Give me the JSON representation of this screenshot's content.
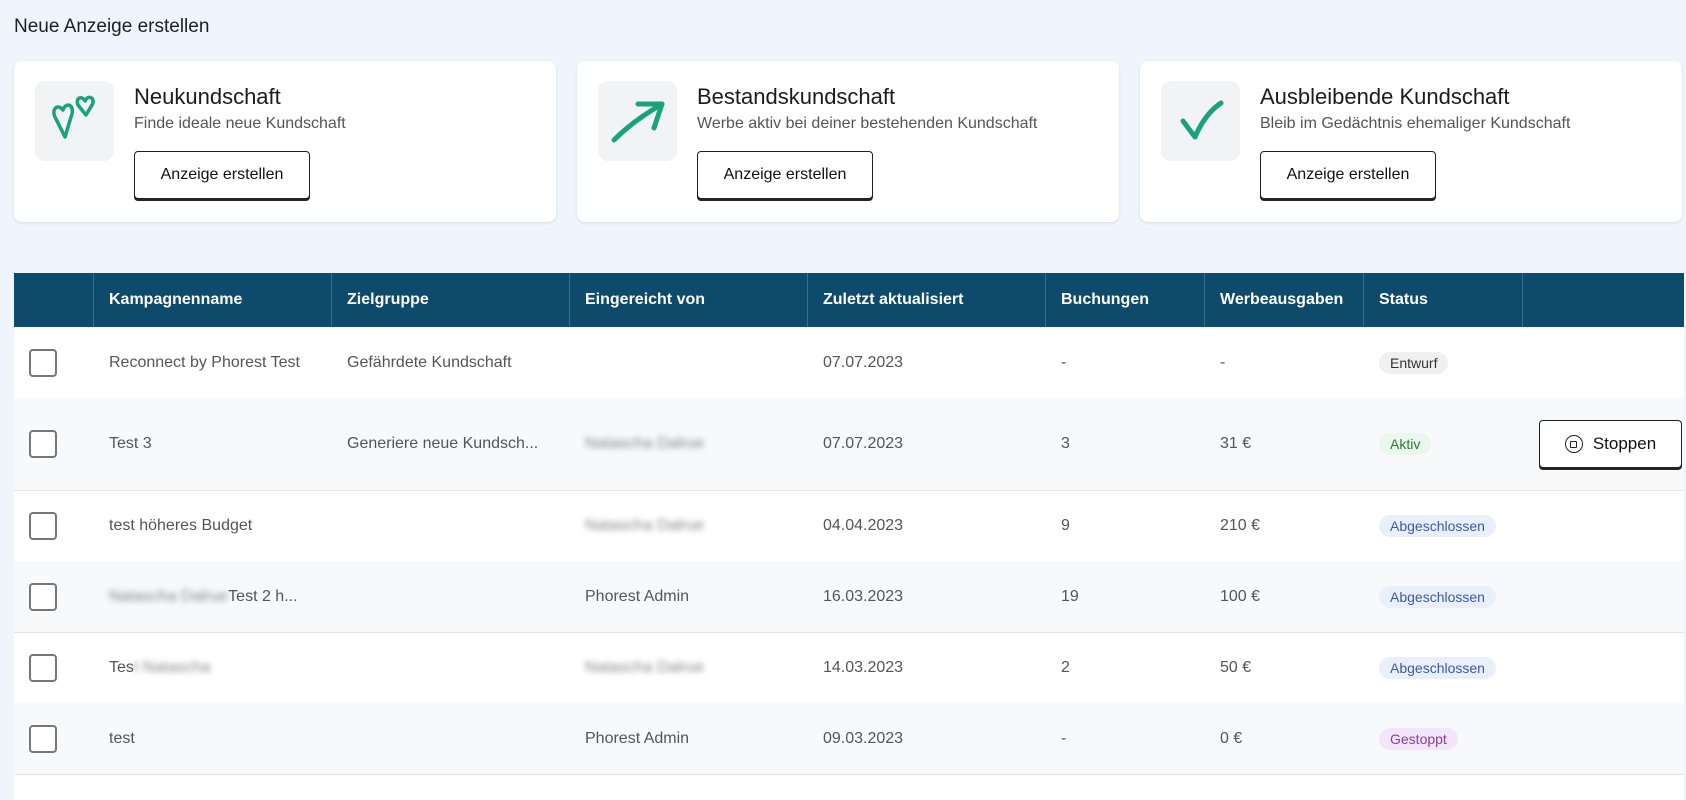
{
  "page": {
    "title": "Neue Anzeige erstellen"
  },
  "cards": [
    {
      "icon": "hearts-icon",
      "title": "Neukundschaft",
      "subtitle": "Finde ideale neue Kundschaft",
      "button": "Anzeige erstellen"
    },
    {
      "icon": "arrow-up-right-icon",
      "title": "Bestandskundschaft",
      "subtitle": "Werbe aktiv bei deiner bestehenden Kundschaft",
      "button": "Anzeige erstellen"
    },
    {
      "icon": "checkmark-icon",
      "title": "Ausbleibende Kundschaft",
      "subtitle": "Bleib im Gedächtnis ehemaliger Kundschaft",
      "button": "Anzeige erstellen"
    }
  ],
  "colors": {
    "accent": "#1aa37a",
    "header_bg": "#0e4a6b",
    "page_bg": "#eef5fd"
  },
  "table": {
    "headers": [
      "Kampagnenname",
      "Zielgruppe",
      "Eingereicht von",
      "Zuletzt aktualisiert",
      "Buchungen",
      "Werbeausgaben",
      "Status"
    ],
    "rows": [
      {
        "name": "Reconnect by Phorest Test",
        "name_blur": "",
        "audience": "Gefährdete Kundschaft",
        "submitted_by": "",
        "submitted_blur": "",
        "updated": "07.07.2023",
        "bookings": "-",
        "spend": "-",
        "status": "Entwurf",
        "status_type": "draft",
        "action": ""
      },
      {
        "name": "Test 3",
        "name_blur": "",
        "audience": "Generiere neue Kundsch...",
        "submitted_by": "",
        "submitted_blur": "Natascha Dalrue",
        "updated": "07.07.2023",
        "bookings": "3",
        "spend": "31 €",
        "status": "Aktiv",
        "status_type": "active",
        "action": "Stoppen"
      },
      {
        "name": "test höheres Budget",
        "name_blur": "",
        "audience": "",
        "submitted_by": "",
        "submitted_blur": "Natascha Dalrue",
        "updated": "04.04.2023",
        "bookings": "9",
        "spend": "210 €",
        "status": "Abgeschlossen",
        "status_type": "done",
        "action": ""
      },
      {
        "name": " Test 2 h...",
        "name_blur": "Natascha Dalrue",
        "audience": "",
        "submitted_by": "Phorest Admin",
        "submitted_blur": "",
        "updated": "16.03.2023",
        "bookings": "19",
        "spend": "100 €",
        "status": "Abgeschlossen",
        "status_type": "done",
        "action": ""
      },
      {
        "name": "Tes",
        "name_blur": "t Natascha",
        "audience": "",
        "submitted_by": "",
        "submitted_blur": "Natascha Dalrue",
        "updated": "14.03.2023",
        "bookings": "2",
        "spend": "50 €",
        "status": "Abgeschlossen",
        "status_type": "done",
        "action": ""
      },
      {
        "name": "test",
        "name_blur": "",
        "audience": "",
        "submitted_by": "Phorest Admin",
        "submitted_blur": "",
        "updated": "09.03.2023",
        "bookings": "-",
        "spend": "0 €",
        "status": "Gestoppt",
        "status_type": "stopped",
        "action": ""
      }
    ]
  }
}
